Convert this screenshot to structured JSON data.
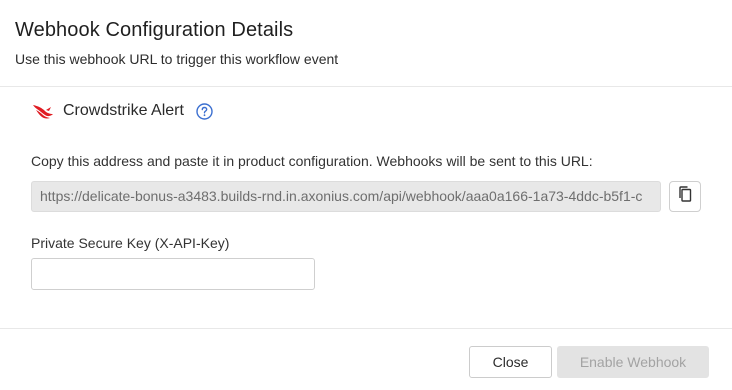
{
  "dialog": {
    "title": "Webhook Configuration Details",
    "subtitle": "Use this webhook URL to trigger this workflow event"
  },
  "integration": {
    "name": "Crowdstrike Alert",
    "logo_icon": "crowdstrike-falcon-logo",
    "help_icon": "question-circle-icon",
    "brand_color": "#e01b22",
    "help_color": "#3b6fd0"
  },
  "url_section": {
    "instruction": "Copy this address and paste it in product configuration. Webhooks will be sent to this URL:",
    "url_value": "https://delicate-bonus-a3483.builds-rnd.in.axonius.com/api/webhook/aaa0a166-1a73-4ddc-b5f1-c",
    "copy_icon": "copy-icon"
  },
  "key_section": {
    "label": "Private Secure Key (X-API-Key)",
    "value": "",
    "placeholder": ""
  },
  "footer": {
    "close_label": "Close",
    "enable_label": "Enable Webhook"
  }
}
